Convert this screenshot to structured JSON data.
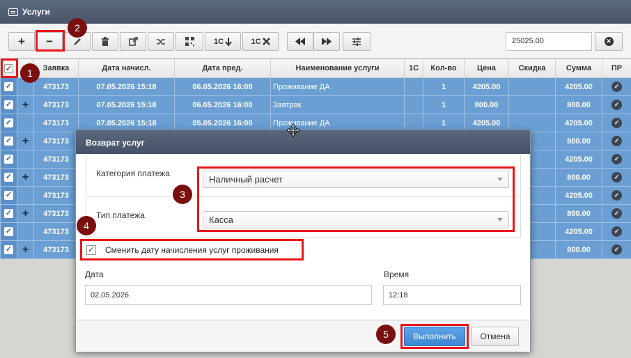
{
  "window": {
    "title": "Услуги"
  },
  "toolbar": {
    "add_label": "+",
    "remove_label": "−",
    "onec_download_label": "1С",
    "onec_delete_label": "1С",
    "search_value": "25025.00"
  },
  "table": {
    "columns": [
      "Заявка",
      "Дата начисл.",
      "Дата пред.",
      "Наименование услуги",
      "1С",
      "Кол-во",
      "Цена",
      "Скидка",
      "Сумма",
      "ПР"
    ],
    "rows": [
      {
        "plus": "",
        "id": "473173",
        "date_charge": "07.05.2026 15:18",
        "date_service": "06.05.2026 16:00",
        "name": "Проживание ДА",
        "onec": "",
        "qty": "1",
        "price": "4205.00",
        "discount": "",
        "sum": "4205.00"
      },
      {
        "plus": "+",
        "id": "473173",
        "date_charge": "07.05.2026 15:18",
        "date_service": "06.05.2026 16:00",
        "name": "Завтрак",
        "onec": "",
        "qty": "1",
        "price": "800.00",
        "discount": "",
        "sum": "800.00"
      },
      {
        "plus": "",
        "id": "473173",
        "date_charge": "07.05.2026 15:18",
        "date_service": "05.05.2026 16:00",
        "name": "Проживание ДА",
        "onec": "",
        "qty": "1",
        "price": "4205.00",
        "discount": "",
        "sum": "4205.00"
      },
      {
        "plus": "+",
        "id": "473173",
        "date_charge": "",
        "date_service": "",
        "name": "",
        "onec": "",
        "qty": "",
        "price": "",
        "discount": "",
        "sum": "800.00"
      },
      {
        "plus": "",
        "id": "473173",
        "date_charge": "",
        "date_service": "",
        "name": "",
        "onec": "",
        "qty": "",
        "price": "",
        "discount": "",
        "sum": "4205.00"
      },
      {
        "plus": "+",
        "id": "473173",
        "date_charge": "",
        "date_service": "",
        "name": "",
        "onec": "",
        "qty": "",
        "price": "",
        "discount": "",
        "sum": "800.00"
      },
      {
        "plus": "",
        "id": "473173",
        "date_charge": "",
        "date_service": "",
        "name": "",
        "onec": "",
        "qty": "",
        "price": "",
        "discount": "",
        "sum": "4205.00"
      },
      {
        "plus": "+",
        "id": "473173",
        "date_charge": "",
        "date_service": "",
        "name": "",
        "onec": "",
        "qty": "",
        "price": "",
        "discount": "",
        "sum": "800.00"
      },
      {
        "plus": "",
        "id": "473173",
        "date_charge": "",
        "date_service": "",
        "name": "",
        "onec": "",
        "qty": "",
        "price": "",
        "discount": "",
        "sum": "4205.00"
      },
      {
        "plus": "+",
        "id": "473173",
        "date_charge": "",
        "date_service": "",
        "name": "",
        "onec": "",
        "qty": "",
        "price": "",
        "discount": "",
        "sum": "800.00"
      }
    ]
  },
  "dialog": {
    "title": "Возврат услуг",
    "payment_category_label": "Категория платежа",
    "payment_category_value": "Наличный расчет",
    "payment_type_label": "Тип платежа",
    "payment_type_value": "Касса",
    "change_date_label": "Сменить дату начисления услуг проживания",
    "date_label": "Дата",
    "date_value": "02.05.2026",
    "time_label": "Время",
    "time_value": "12:18",
    "execute_label": "Выполнить",
    "cancel_label": "Отмена"
  },
  "annotations": [
    "1",
    "2",
    "3",
    "4",
    "5"
  ],
  "colors": {
    "row_selected": "#6b9fd4",
    "highlight": "#e8161b",
    "marker": "#7b0f0f",
    "primary_button": "#4a90d9"
  }
}
